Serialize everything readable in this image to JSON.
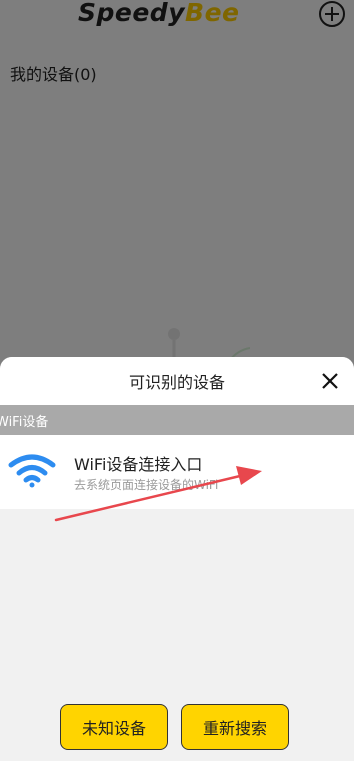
{
  "header": {
    "logo_part1": "Speedy",
    "logo_part2": "Bee",
    "add_icon": "plus-circle-icon"
  },
  "main": {
    "my_devices_label": "我的设备(0)"
  },
  "sheet": {
    "title": "可识别的设备",
    "close_icon": "close-icon",
    "section_label": "WiFi设备",
    "wifi_entry": {
      "icon": "wifi-icon",
      "title": "WiFi设备连接入口",
      "subtitle": "去系统页面连接设备的WiFi"
    }
  },
  "buttons": {
    "unknown_device": "未知设备",
    "rescan": "重新搜索"
  },
  "colors": {
    "accent": "#ffd400",
    "wifi": "#2d8cf0",
    "annotation_arrow": "#e8474d"
  }
}
